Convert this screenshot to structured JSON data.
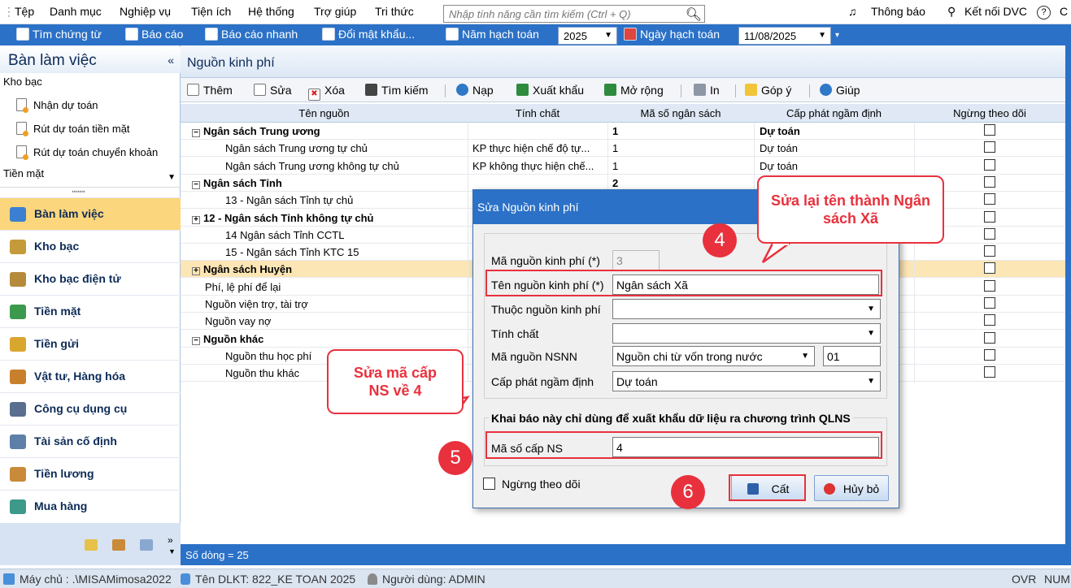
{
  "menu": {
    "items": [
      "Tệp",
      "Danh mục",
      "Nghiệp vụ",
      "Tiện ích",
      "Hệ thống",
      "Trợ giúp",
      "Tri thức"
    ],
    "search_placeholder": "Nhập tính năng cần tìm kiếm (Ctrl + Q)",
    "notification": "Thông báo",
    "connect": "Kết nối DVC",
    "cut": "C"
  },
  "toolbar": {
    "search_docs": "Tìm chứng từ",
    "report": "Báo cáo",
    "quick_report": "Báo cáo nhanh",
    "change_password": "Đổi mật khẩu...",
    "fiscal_year_label": "Năm hạch toán",
    "fiscal_year": "2025",
    "posting_date_label": "Ngày hạch toán",
    "posting_date": "11/08/2025"
  },
  "left": {
    "title": "Bàn làm việc",
    "collapse": "«",
    "section_kho_bac": "Kho bạc",
    "links": [
      "Nhận dự toán",
      "Rút dự toán tiền mặt",
      "Rút dự toán chuyển khoản"
    ],
    "section_tien_mat": "Tiền mặt",
    "grip": ",,,,,,,,,",
    "nav": [
      "Bàn làm việc",
      "Kho bạc",
      "Kho bạc điện tử",
      "Tiền mặt",
      "Tiền gửi",
      "Vật tư, Hàng hóa",
      "Công cụ dụng cụ",
      "Tài sản cố định",
      "Tiền lương",
      "Mua hàng"
    ],
    "more": "»"
  },
  "main": {
    "title": "Nguồn kinh phí",
    "actions": {
      "add": "Thêm",
      "edit": "Sửa",
      "delete": "Xóa",
      "find": "Tìm kiếm",
      "load": "Nạp",
      "export": "Xuất khẩu",
      "expand": "Mở rộng",
      "print": "In",
      "feedback": "Góp ý",
      "help": "Giúp"
    },
    "columns": [
      "Tên nguồn",
      "Tính chất",
      "Mã số ngân sách",
      "Cấp phát ngầm định",
      "Ngừng theo dõi"
    ],
    "rows": [
      {
        "name": "Ngân sách Trung ương",
        "tinh_chat": "",
        "ma": "1",
        "cap_phat": "Dự toán",
        "bold": true,
        "toggle": "−"
      },
      {
        "name": "Ngân sách Trung ương tự chủ",
        "tinh_chat": "KP thực hiện chế độ tự...",
        "ma": "1",
        "cap_phat": "Dự toán"
      },
      {
        "name": "Ngân sách Trung ương không tự chủ",
        "tinh_chat": "KP không thực hiện chế...",
        "ma": "1",
        "cap_phat": "Dự toán"
      },
      {
        "name": "Ngân sách Tỉnh",
        "tinh_chat": "",
        "ma": "2",
        "cap_phat": "",
        "bold": true,
        "toggle": "−"
      },
      {
        "name": "13 - Ngân sách Tỉnh tự chủ",
        "tinh_chat": "",
        "ma": "",
        "cap_phat": ""
      },
      {
        "name": "12 - Ngân sách Tỉnh không tự chủ",
        "tinh_chat": "",
        "ma": "",
        "cap_phat": "",
        "bold": true,
        "toggle": "+"
      },
      {
        "name": "14 Ngân sách Tỉnh CCTL",
        "tinh_chat": "",
        "ma": "",
        "cap_phat": ""
      },
      {
        "name": "15 - Ngân sách Tỉnh KTC 15",
        "tinh_chat": "",
        "ma": "",
        "cap_phat": ""
      },
      {
        "name": "Ngân sách Huyện",
        "tinh_chat": "",
        "ma": "",
        "cap_phat": "",
        "bold": true,
        "toggle": "+",
        "highlight": true
      },
      {
        "name": "Phí, lệ phí để lại",
        "tinh_chat": "",
        "ma": "",
        "cap_phat": ""
      },
      {
        "name": "Nguồn viện trợ, tài trợ",
        "tinh_chat": "",
        "ma": "",
        "cap_phat": ""
      },
      {
        "name": "Nguồn vay nợ",
        "tinh_chat": "",
        "ma": "",
        "cap_phat": ""
      },
      {
        "name": "Nguồn khác",
        "tinh_chat": "",
        "ma": "",
        "cap_phat": "",
        "bold": true,
        "toggle": "−"
      },
      {
        "name": "Nguồn thu học phí",
        "tinh_chat": "",
        "ma": "",
        "cap_phat": ""
      },
      {
        "name": "Nguồn thu khác",
        "tinh_chat": "",
        "ma": "",
        "cap_phat": ""
      }
    ],
    "row_count": "Số dòng = 25"
  },
  "dialog": {
    "title": "Sửa Nguồn kinh phí",
    "ma_nguon_label": "Mã nguồn kinh phí (*)",
    "ma_nguon_value": "3",
    "ten_nguon_label": "Tên nguồn kinh phí (*)",
    "ten_nguon_value": "Ngân sách Xã",
    "thuoc_nguon_label": "Thuộc nguồn kinh phí",
    "thuoc_nguon_value": "",
    "tinh_chat_label": "Tính chất",
    "tinh_chat_value": "",
    "ma_nsnn_label": "Mã nguồn NSNN",
    "ma_nsnn_value": "Nguồn chi từ vốn trong nước",
    "ma_nsnn_code": "01",
    "cap_phat_label": "Cấp phát ngầm định",
    "cap_phat_value": "Dự toán",
    "group2_title": "Khai báo này chỉ dùng để xuất khẩu dữ liệu ra chương trình QLNS",
    "ma_cap_ns_label": "Mã số cấp NS",
    "ma_cap_ns_value": "4",
    "stop_tracking_label": "Ngừng theo dõi",
    "save_label": "Cất",
    "cancel_label": "Hủy bỏ"
  },
  "annotations": {
    "callout_name": "Sửa lại tên thành Ngân sách Xã",
    "callout_code": "Sửa mã cấp NS về 4",
    "step4": "4",
    "step5": "5",
    "step6": "6",
    "color": "#e8313d"
  },
  "status": {
    "server": "Máy chủ : .\\MISAMimosa2022",
    "db": "Tên DLKT: 822_KE TOAN 2025",
    "user": "Người dùng: ADMIN",
    "ovr": "OVR",
    "num": "NUM"
  }
}
